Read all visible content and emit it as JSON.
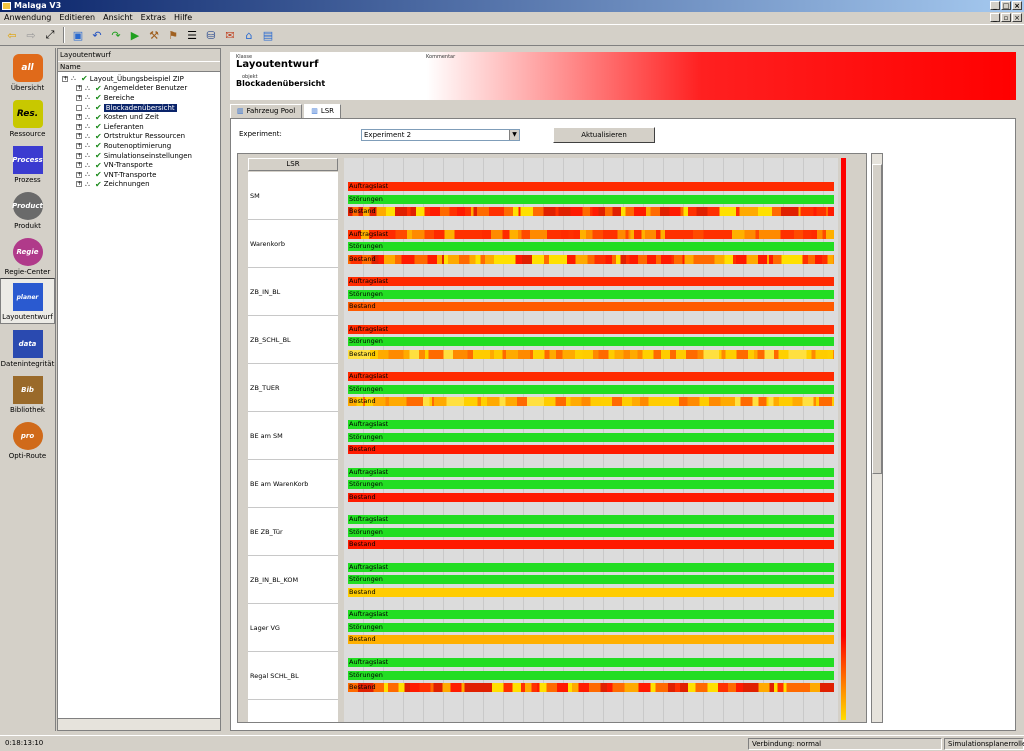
{
  "window": {
    "title": "Malaga V3"
  },
  "menu": [
    "Anwendung",
    "Editieren",
    "Ansicht",
    "Extras",
    "Hilfe"
  ],
  "nav": [
    {
      "label": "Übersicht",
      "icon": "all-icon",
      "glyph": "all",
      "color": "#e06a1a"
    },
    {
      "label": "Ressource",
      "icon": "res-icon",
      "glyph": "Res.",
      "color": "#c8c800"
    },
    {
      "label": "Prozess",
      "icon": "process-icon",
      "glyph": "Process",
      "color": "#3b3bd0"
    },
    {
      "label": "Produkt",
      "icon": "product-icon",
      "glyph": "Product",
      "color": "#6a6a6a"
    },
    {
      "label": "Regie-Center",
      "icon": "regie-center-icon",
      "glyph": "Regie",
      "color": "#b03a8a"
    },
    {
      "label": "Layoutentwurf",
      "icon": "layout-icon",
      "glyph": "planer",
      "color": "#2a5ad0"
    },
    {
      "label": "Datenintegrität",
      "icon": "data-quality-icon",
      "glyph": "data",
      "color": "#2a4ab0"
    },
    {
      "label": "Bibliothek",
      "icon": "library-icon",
      "glyph": "Bib",
      "color": "#9a6a2a"
    },
    {
      "label": "Opti-Route",
      "icon": "opti-route-icon",
      "glyph": "pro",
      "color": "#d06a1a"
    }
  ],
  "tree_panel": {
    "title": "Layoutentwurf",
    "column": "Name",
    "items": [
      {
        "label": "Layout_Übungsbeispiel ZIP",
        "indent": 0
      },
      {
        "label": "Angemeldeter Benutzer",
        "indent": 1
      },
      {
        "label": "Bereiche",
        "indent": 1
      },
      {
        "label": "Blockadenübersicht",
        "indent": 1,
        "selected": true
      },
      {
        "label": "Kosten und Zeit",
        "indent": 1
      },
      {
        "label": "Lieferanten",
        "indent": 1
      },
      {
        "label": "Ortstruktur Ressourcen",
        "indent": 1
      },
      {
        "label": "Routenoptimierung",
        "indent": 1
      },
      {
        "label": "Simulationseinstellungen",
        "indent": 1
      },
      {
        "label": "VN-Transporte",
        "indent": 1
      },
      {
        "label": "VNT-Transporte",
        "indent": 1
      },
      {
        "label": "Zeichnungen",
        "indent": 1
      }
    ]
  },
  "header": {
    "klasse_label": "Klasse",
    "title": "Layoutentwurf",
    "objekt_label": "objekt",
    "subtitle": "Blockadenübersicht",
    "kommentar_label": "Kommentar"
  },
  "tabs": [
    {
      "label": "Fahrzeug Pool"
    },
    {
      "label": "LSR"
    }
  ],
  "experiment": {
    "label": "Experiment:",
    "value": "Experiment 2"
  },
  "refresh_label": "Aktualisieren",
  "grid": {
    "header": "LSR",
    "series_labels": [
      "Auftragslast",
      "Störungen",
      "Bestand"
    ],
    "rows": [
      {
        "name": "SM",
        "auftragslast": "#ff2a00",
        "stoerungen": "#22dd22",
        "bestand": "mixed-red"
      },
      {
        "name": "Warenkorb",
        "auftragslast": "mixed-orange",
        "stoerungen": "#22dd22",
        "bestand": "mixed-red"
      },
      {
        "name": "ZB_IN_BL",
        "auftragslast": "#ff2a00",
        "stoerungen": "#22dd22",
        "bestand": "#ff5a00"
      },
      {
        "name": "ZB_SCHL_BL",
        "auftragslast": "#ff2a00",
        "stoerungen": "#22dd22",
        "bestand": "mixed-yellow"
      },
      {
        "name": "ZB_TUER",
        "auftragslast": "#ff2a00",
        "stoerungen": "#22dd22",
        "bestand": "mixed-yellow"
      },
      {
        "name": "BE am SM",
        "auftragslast": "#22dd22",
        "stoerungen": "#22dd22",
        "bestand": "#ff1a00"
      },
      {
        "name": "BE am WarenKorb",
        "auftragslast": "#22dd22",
        "stoerungen": "#22dd22",
        "bestand": "#ff1a00"
      },
      {
        "name": "BE ZB_Tür",
        "auftragslast": "#22dd22",
        "stoerungen": "#22dd22",
        "bestand": "#ff1a00"
      },
      {
        "name": "ZB_IN_BL_KOM",
        "auftragslast": "#22dd22",
        "stoerungen": "#22dd22",
        "bestand": "#ffcc00"
      },
      {
        "name": "Lager VG",
        "auftragslast": "#22dd22",
        "stoerungen": "#22dd22",
        "bestand": "#ffb000"
      },
      {
        "name": "Regal SCHL_BL",
        "auftragslast": "#22dd22",
        "stoerungen": "#22dd22",
        "bestand": "mixed-red"
      }
    ]
  },
  "status": {
    "time": "0:18:13:10",
    "connection": "Verbindung: normal",
    "role": "Simulationsplanerrolle"
  }
}
